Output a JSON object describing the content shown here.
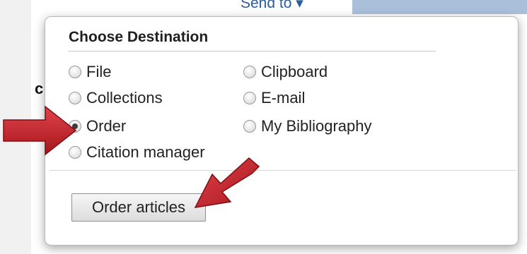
{
  "background": {
    "send_to_label": "Send to ▾",
    "partial_heading": "c"
  },
  "popup": {
    "title": "Choose Destination",
    "options": [
      {
        "label": "File",
        "checked": false
      },
      {
        "label": "Clipboard",
        "checked": false
      },
      {
        "label": "Collections",
        "checked": false
      },
      {
        "label": "E-mail",
        "checked": false
      },
      {
        "label": "Order",
        "checked": true
      },
      {
        "label": "My Bibliography",
        "checked": false
      },
      {
        "label": "Citation manager",
        "checked": false
      }
    ],
    "action_button": "Order articles"
  },
  "annotations": {
    "arrow_color": "#c0242a",
    "arrow_icon": "red-arrow-icon"
  }
}
